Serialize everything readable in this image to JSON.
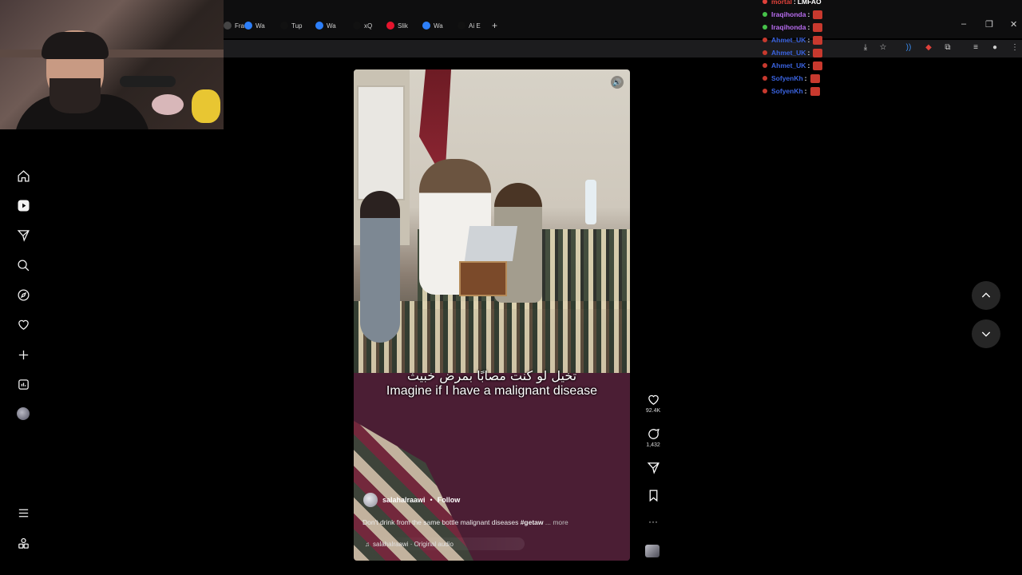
{
  "browser": {
    "tabs": [
      {
        "label": "Fra",
        "color": "#444"
      },
      {
        "label": "Wa",
        "color": "#2d7ff9"
      },
      {
        "label": "Tup",
        "color": "#111"
      },
      {
        "label": "Wa",
        "color": "#2d7ff9"
      },
      {
        "label": "xQ",
        "color": "#111"
      },
      {
        "label": "Slik",
        "color": "#e5142d"
      },
      {
        "label": "Wa",
        "color": "#2d7ff9"
      },
      {
        "label": "Ai E",
        "color": "#111"
      }
    ],
    "new_tab": "+",
    "window_controls": {
      "minimize": "–",
      "restore": "❐",
      "close": "✕"
    }
  },
  "sidebar": {
    "items": [
      {
        "name": "home",
        "icon": "home-icon"
      },
      {
        "name": "reels",
        "icon": "reels-icon"
      },
      {
        "name": "messages",
        "icon": "send-icon"
      },
      {
        "name": "search",
        "icon": "search-icon"
      },
      {
        "name": "explore",
        "icon": "compass-icon"
      },
      {
        "name": "notifications",
        "icon": "heart-icon"
      },
      {
        "name": "create",
        "icon": "plus-icon"
      },
      {
        "name": "dashboard",
        "icon": "chart-icon"
      },
      {
        "name": "profile",
        "icon": "avatar"
      }
    ],
    "bottom": [
      {
        "name": "more",
        "icon": "menu-icon"
      },
      {
        "name": "also-from-meta",
        "icon": "apps-icon"
      }
    ]
  },
  "reel": {
    "subtitle_ar": "تخيل لو كنت مصابًا بمرض خبيث",
    "subtitle_en": "Imagine if I have a malignant disease",
    "author": "salahalraawi",
    "separator": "•",
    "follow_label": "Follow",
    "caption_text": "Don't drink from the same bottle malignant diseases ",
    "caption_hashtag": "#getaw",
    "caption_more": "... more",
    "audio": "salahalraawi · Original audio",
    "mute_icon": "speaker-icon"
  },
  "actions": {
    "likes": "92.4K",
    "comments": "1,432"
  },
  "chat": {
    "messages": [
      {
        "user": "mortal",
        "text": "LMFAO",
        "color": "#e0413a",
        "dot": "#e0413a"
      },
      {
        "user": "Iraqihonda",
        "text": "",
        "color": "#b86cf0",
        "dot": "#46c24a"
      },
      {
        "user": "Iraqihonda",
        "text": "",
        "color": "#b86cf0",
        "dot": "#46c24a"
      },
      {
        "user": "Ahmet_UK",
        "text": "",
        "color": "#3a63e0",
        "dot": "#c8392e"
      },
      {
        "user": "Ahmet_UK",
        "text": "",
        "color": "#3a63e0",
        "dot": "#c8392e"
      },
      {
        "user": "Ahmet_UK",
        "text": "",
        "color": "#3a63e0",
        "dot": "#c8392e"
      },
      {
        "user": "SofyenKh",
        "text": "",
        "color": "#3a63e0",
        "dot": "#c8392e"
      },
      {
        "user": "SofyenKh",
        "text": "",
        "color": "#3a63e0",
        "dot": "#c8392e"
      }
    ],
    "separator": ":"
  }
}
